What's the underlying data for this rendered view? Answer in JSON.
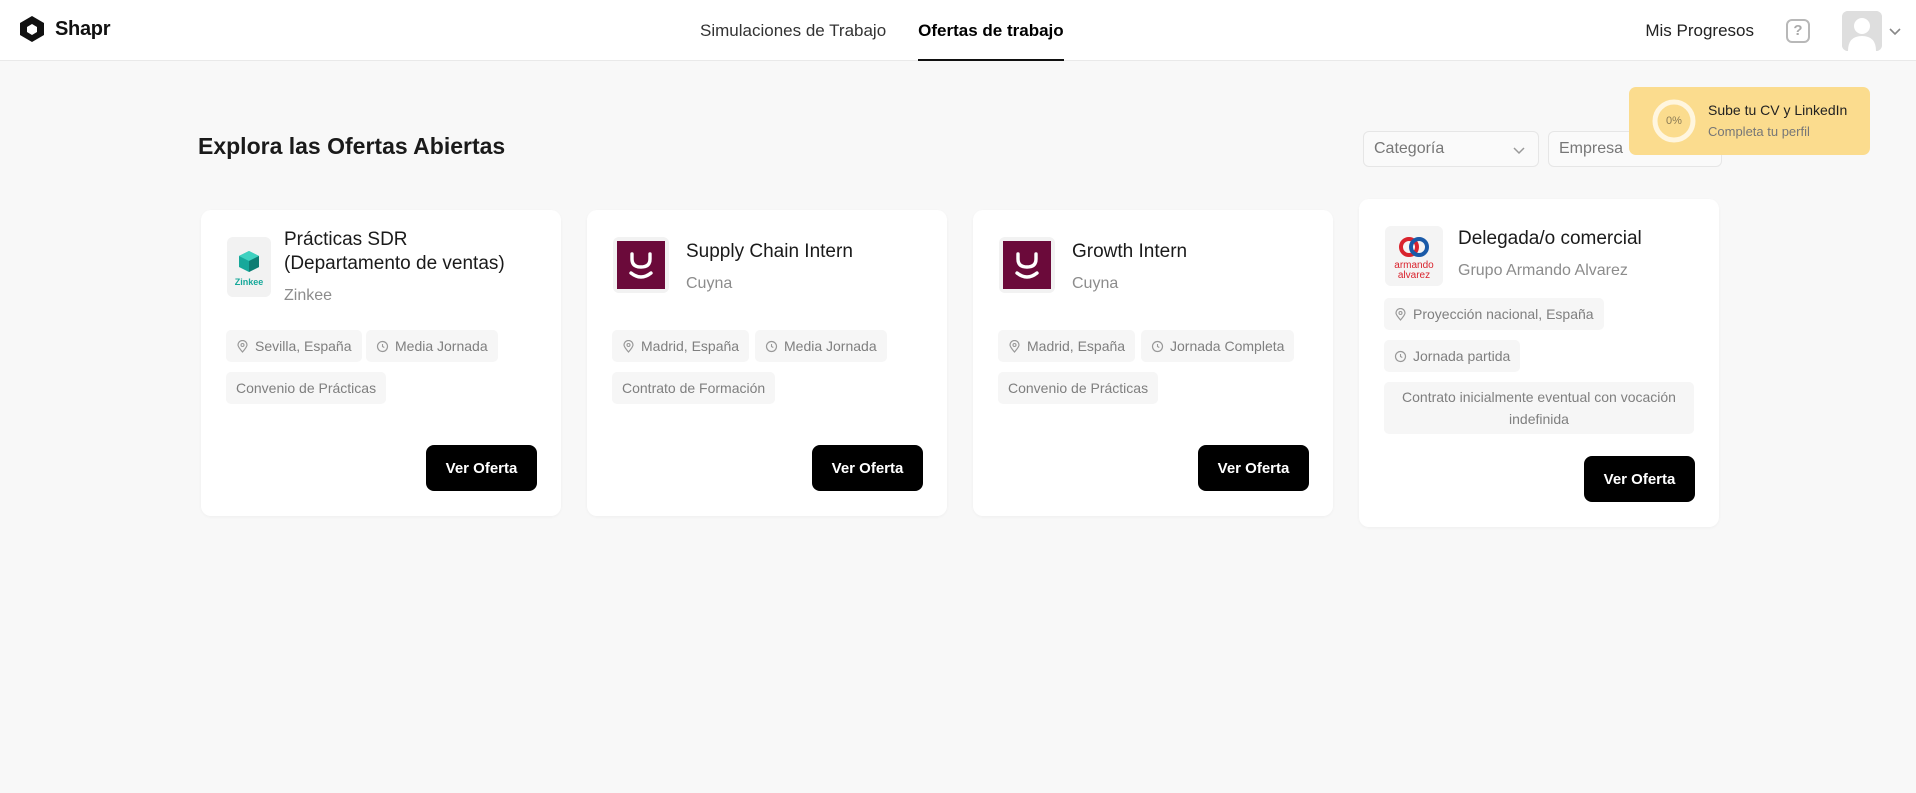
{
  "header": {
    "brand": "Shapr",
    "tabs": [
      {
        "label": "Simulaciones de Trabajo",
        "active": false
      },
      {
        "label": "Ofertas de trabajo",
        "active": true
      }
    ],
    "progress_link": "Mis Progresos",
    "help_icon": "question-icon",
    "help_glyph": "?"
  },
  "main": {
    "title": "Explora las Ofertas Abiertas",
    "filters": {
      "category_placeholder": "Categoría",
      "company_placeholder": "Empresa"
    }
  },
  "toast": {
    "progress": "0%",
    "title": "Sube tu CV y LinkedIn",
    "subtitle": "Completa tu perfil",
    "color": "#fbdc8e"
  },
  "jobs": [
    {
      "title_line1": "Prácticas SDR",
      "title_line2": "(Departamento de ventas)",
      "company": "Zinkee",
      "logo_text": "Zinkee",
      "location": "Sevilla, España",
      "schedule": "Media Jornada",
      "contract": "Convenio de Prácticas",
      "cta": "Ver Oferta"
    },
    {
      "title": "Supply Chain Intern",
      "company": "Cuyna",
      "location": "Madrid, España",
      "schedule": "Media Jornada",
      "contract": "Contrato de Formación",
      "cta": "Ver Oferta"
    },
    {
      "title": "Growth Intern",
      "company": "Cuyna",
      "location": "Madrid, España",
      "schedule": "Jornada Completa",
      "contract": "Convenio de Prácticas",
      "cta": "Ver Oferta"
    },
    {
      "title": "Delegada/o comercial",
      "company": "Grupo Armando Alvarez",
      "logo_text_top": "armando",
      "logo_text_bottom": "alvarez",
      "location": "Proyección nacional, España",
      "schedule": "Jornada partida",
      "contract": "Contrato inicialmente eventual con vocación indefinida",
      "cta": "Ver Oferta"
    }
  ],
  "colors": {
    "background": "#f8f8f8",
    "card": "#ffffff",
    "cta": "#000000",
    "cuyna_brand": "#6b0a3a",
    "zinkee_brand": "#17a89a"
  }
}
